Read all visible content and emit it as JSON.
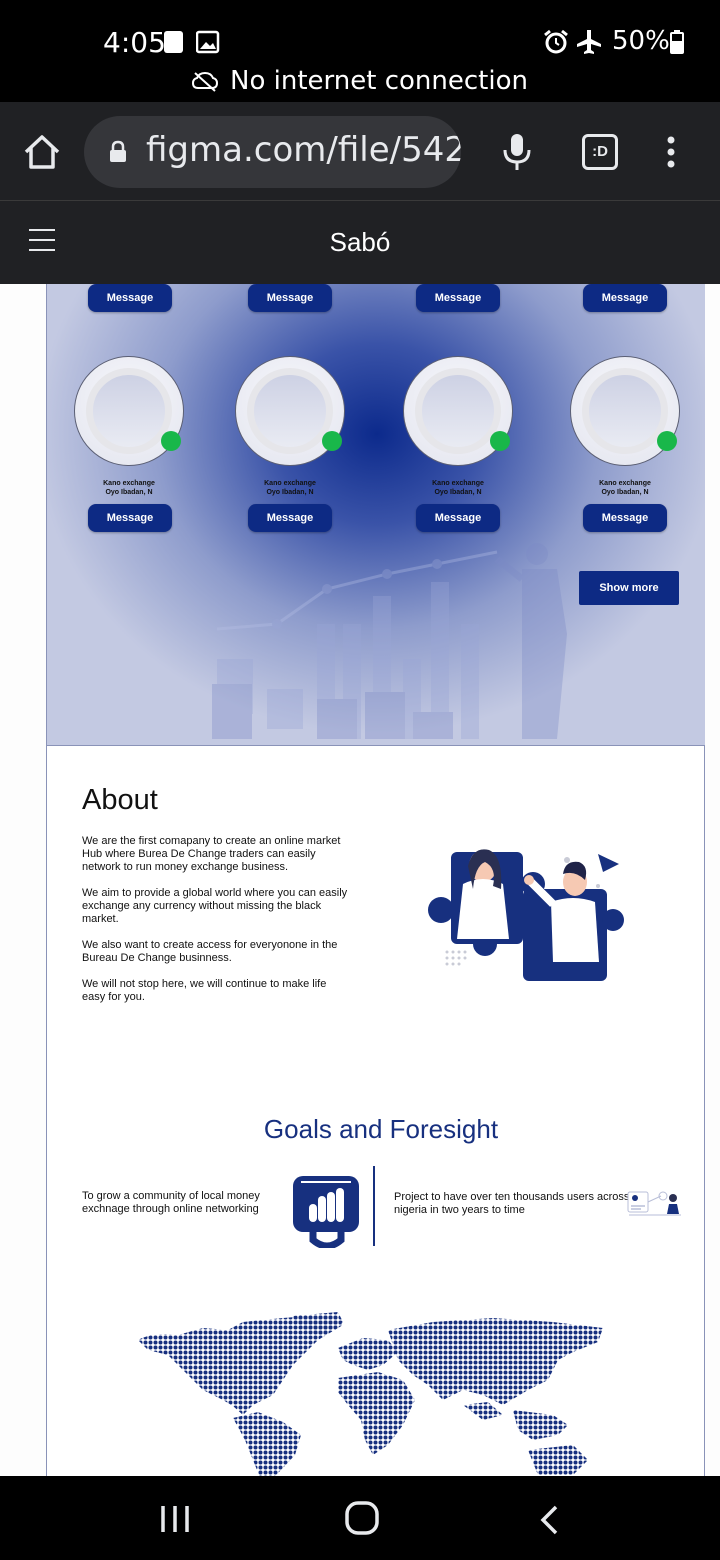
{
  "status_bar": {
    "time": "4:05",
    "battery": "50%",
    "connection_notice": "No internet connection"
  },
  "browser": {
    "url": "figma.com/file/542",
    "tab_label": ":D"
  },
  "app": {
    "title": "Sabó"
  },
  "cards": {
    "top_row": [
      {
        "button": "Message"
      },
      {
        "button": "Message"
      },
      {
        "button": "Message"
      },
      {
        "button": "Message"
      }
    ],
    "row2": [
      {
        "line1": "Kano exchange",
        "line2": "Oyo Ibadan, N",
        "button": "Message"
      },
      {
        "line1": "Kano exchange",
        "line2": "Oyo Ibadan, N",
        "button": "Message"
      },
      {
        "line1": "Kano exchange",
        "line2": "Oyo Ibadan, N",
        "button": "Message"
      },
      {
        "line1": "Kano exchange",
        "line2": "Oyo Ibadan, N",
        "button": "Message"
      }
    ],
    "show_more": "Show more"
  },
  "about": {
    "title": "About",
    "paragraphs": [
      "We are the first comapany to create an online market Hub where Burea De Change traders can easily network to run money exchange business.",
      "We aim to provide a global world where you can easily exchange any currency without missing the black market.",
      "We also want to create access for everyonone in the Bureau De Change businness.",
      "We will not stop here, we will continue to make life",
      "easy for you."
    ]
  },
  "goals": {
    "title": "Goals and Foresight",
    "left": "To  grow a community of local money exchnage through online networking",
    "right": "Project to have over ten thousands users across nigeria in two years to time"
  },
  "colors": {
    "brand": "#0d2a84",
    "online": "#19b74a"
  }
}
